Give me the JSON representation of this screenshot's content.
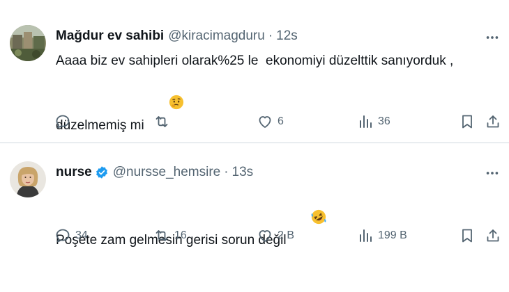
{
  "tweets": [
    {
      "display_name": "Mağdur ev sahibi",
      "handle": "@kiracimagduru",
      "dot": "·",
      "time": "12s",
      "text": "Aaaa biz ev sahipleri olarak%25 le  ekonomiyi düzelttik sanıyorduk ,\ndüzelmemiş mi",
      "emoji": "thinking-face",
      "replies": "",
      "retweets": "",
      "likes": "6",
      "views": "36"
    },
    {
      "display_name": "nurse",
      "handle": "@nursse_hemsire",
      "dot": "·",
      "time": "13s",
      "text": "Poşete zam gelmesin gerisi sorun değil",
      "emoji": "rolling-laughing-face",
      "replies": "34",
      "retweets": "16",
      "likes": "2 B",
      "views": "199 B"
    }
  ],
  "colors": {
    "text": "#0f1419",
    "secondary": "#536471",
    "verified": "#1d9bf0",
    "divider": "#cfd9de"
  }
}
